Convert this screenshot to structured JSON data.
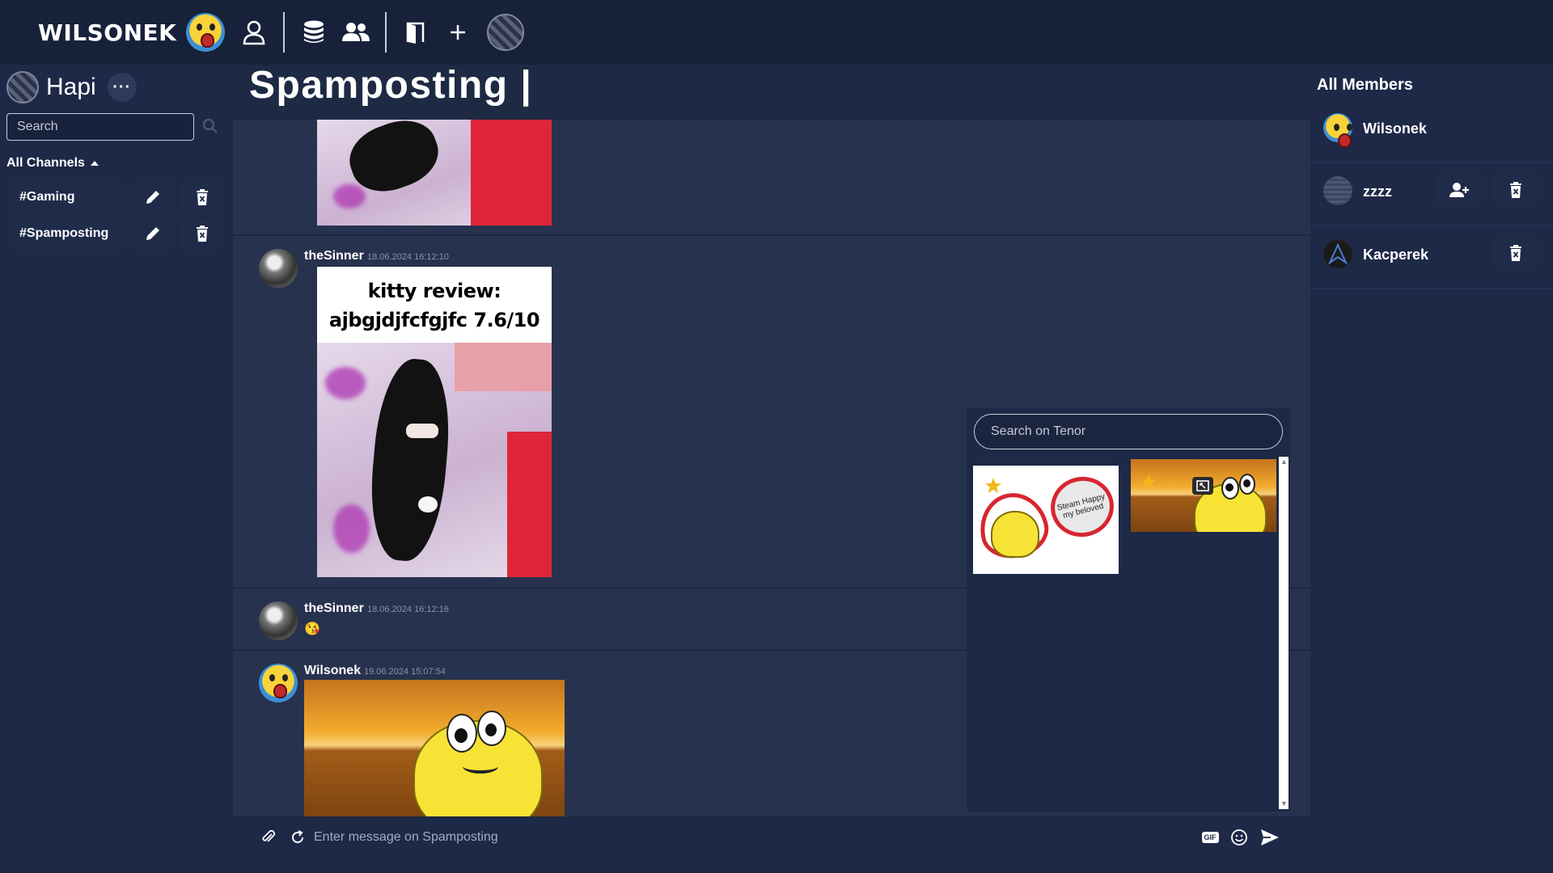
{
  "topbar": {
    "brand": "WILSONEK",
    "icons": [
      "user-icon",
      "database-icon",
      "users-icon",
      "door-icon",
      "plus-icon",
      "server-cube-icon"
    ]
  },
  "sidebar": {
    "server_name": "Hapi",
    "more_label": "···",
    "search_placeholder": "Search",
    "all_channels_label": "All Channels",
    "channels": [
      {
        "label": "#Gaming"
      },
      {
        "label": "#Spamposting"
      }
    ]
  },
  "header": {
    "title": "Spamposting |"
  },
  "messages": [
    {
      "author": "theSinner",
      "time": "18.06.2024 16:12:10",
      "image_caption": "kitty review:\najbgjdjfcfgjfc 7.6/10"
    },
    {
      "author": "theSinner",
      "time": "18.06.2024 16:12:16",
      "content": "😘"
    },
    {
      "author": "Wilsonek",
      "time": "19.06.2024 15:07:54"
    }
  ],
  "gif_picker": {
    "search_placeholder": "Search on Tenor",
    "tile1_text": "Steam Happy my beloved"
  },
  "composer": {
    "placeholder": "Enter message on Spamposting",
    "gif_label": "GIF"
  },
  "members": {
    "title": "All Members",
    "list": [
      {
        "name": "Wilsonek"
      },
      {
        "name": "zzzz"
      },
      {
        "name": "Kacperek"
      }
    ]
  },
  "colors": {
    "background": "#1e2a44",
    "topbar": "#17213a",
    "panel": "#1d2947",
    "chat": "#27324e",
    "accent_yellow": "#f8d33a"
  }
}
